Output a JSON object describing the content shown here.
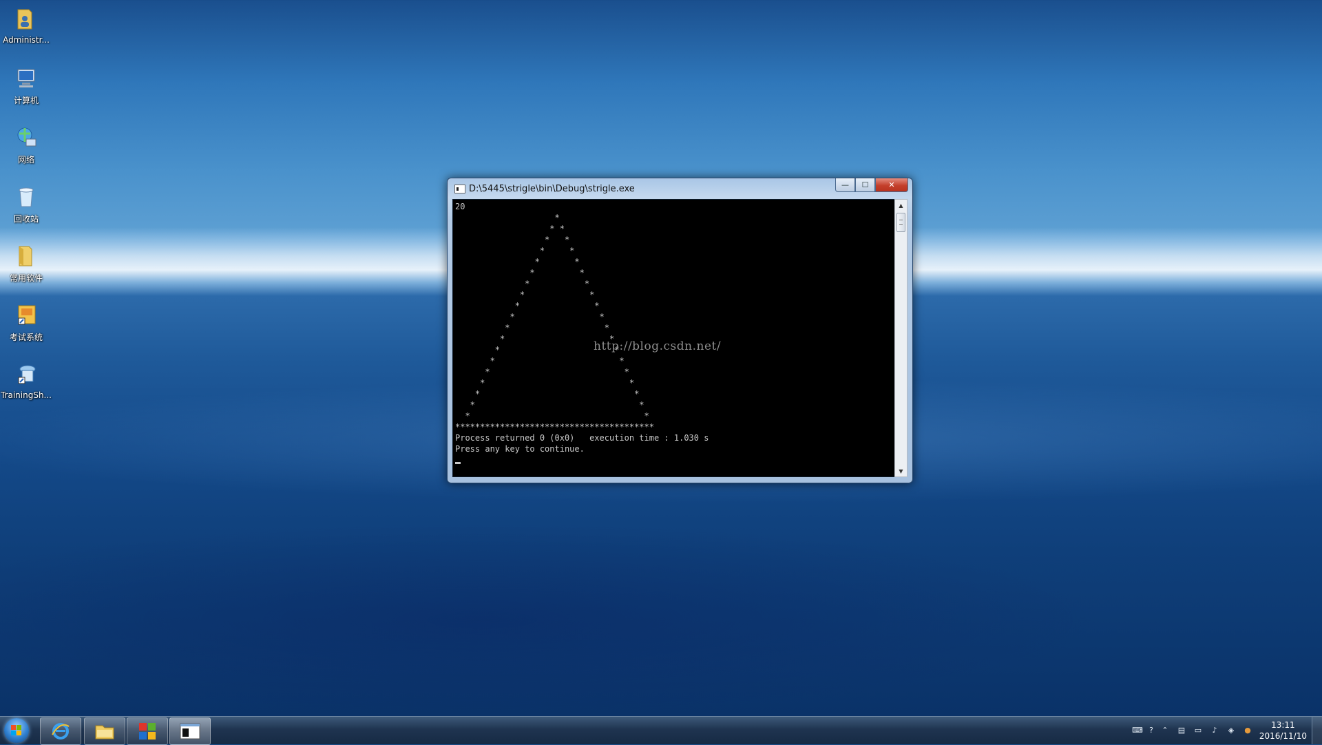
{
  "desktop": {
    "icons": [
      {
        "label": "Administr...",
        "icon": "user-folder-icon"
      },
      {
        "label": "计算机",
        "icon": "computer-icon"
      },
      {
        "label": "网络",
        "icon": "network-icon"
      },
      {
        "label": "回收站",
        "icon": "recycle-bin-icon"
      },
      {
        "label": "常用软件",
        "icon": "folder-icon"
      },
      {
        "label": "考试系统",
        "icon": "exam-system-shortcut-icon"
      },
      {
        "label": "TrainingSh...",
        "icon": "training-shortcut-icon"
      }
    ]
  },
  "console": {
    "title": "D:\\5445\\strigle\\bin\\Debug\\strigle.exe",
    "input_line": "20",
    "triangle_rows": 19,
    "base_line": "****************************************",
    "status_line": "Process returned 0 (0x0)   execution time : 1.030 s",
    "prompt_line": "Press any key to continue.",
    "watermark": "http://blog.csdn.net/",
    "buttons": {
      "minimize": "—",
      "maximize": "☐",
      "close": "✕"
    }
  },
  "taskbar": {
    "pinned": [
      {
        "name": "internet-explorer",
        "icon": "ie-icon"
      },
      {
        "name": "file-explorer",
        "icon": "folder-icon"
      },
      {
        "name": "office-app",
        "icon": "office-icon"
      },
      {
        "name": "console-app",
        "icon": "console-icon"
      }
    ],
    "tray_icons": [
      "keyboard-icon",
      "help-icon",
      "chevron-icon",
      "printer-icon",
      "network-tray-icon",
      "volume-icon",
      "security-icon",
      "app-tray-icon"
    ],
    "time": "13:11",
    "date": "2016/11/10"
  },
  "colors": {
    "console_bg": "#000000",
    "console_text": "#c8c8c8",
    "close_btn": "#c4402c"
  }
}
